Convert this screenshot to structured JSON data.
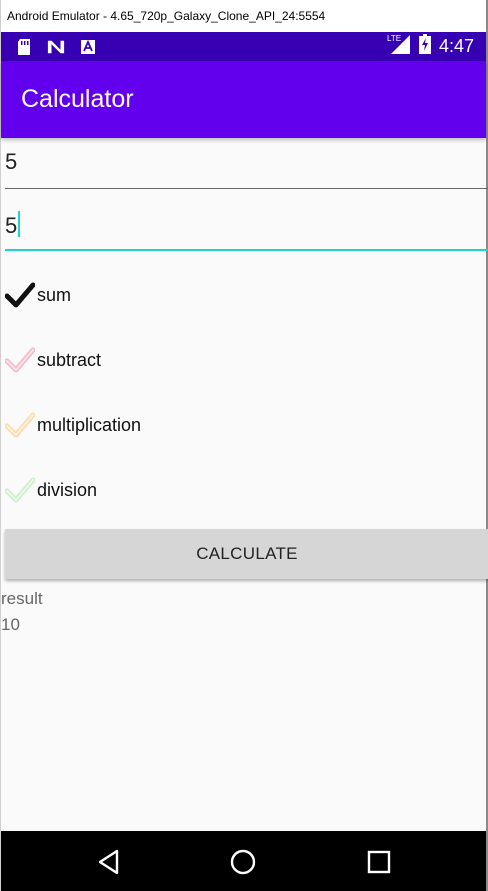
{
  "window": {
    "title": "Android Emulator - 4.65_720p_Galaxy_Clone_API_24:5554"
  },
  "status_bar": {
    "time": "4:47",
    "network": "LTE",
    "left_icons": [
      "sd-card-icon",
      "n-logo-icon",
      "a-box-icon"
    ],
    "right_icons": [
      "lte-signal-icon",
      "battery-charging-icon"
    ]
  },
  "app_bar": {
    "title": "Calculator",
    "color": "#6200ee",
    "status_color": "#3700b3"
  },
  "inputs": [
    {
      "value": "5",
      "focused": false
    },
    {
      "value": "5",
      "focused": true
    }
  ],
  "operations": [
    {
      "label": "sum",
      "checked": true,
      "check_color": "#111111"
    },
    {
      "label": "subtract",
      "checked": false,
      "check_color": "#f2b8c6"
    },
    {
      "label": "multiplication",
      "checked": false,
      "check_color": "#ffd9a8"
    },
    {
      "label": "division",
      "checked": false,
      "check_color": "#c9efc9"
    }
  ],
  "calculate_button": {
    "label": "CALCULATE"
  },
  "result": {
    "label": "result",
    "value": "10"
  },
  "accent_color": "#1fd3c6",
  "nav_bar": {
    "buttons": [
      "back-icon",
      "home-icon",
      "recents-icon"
    ]
  }
}
